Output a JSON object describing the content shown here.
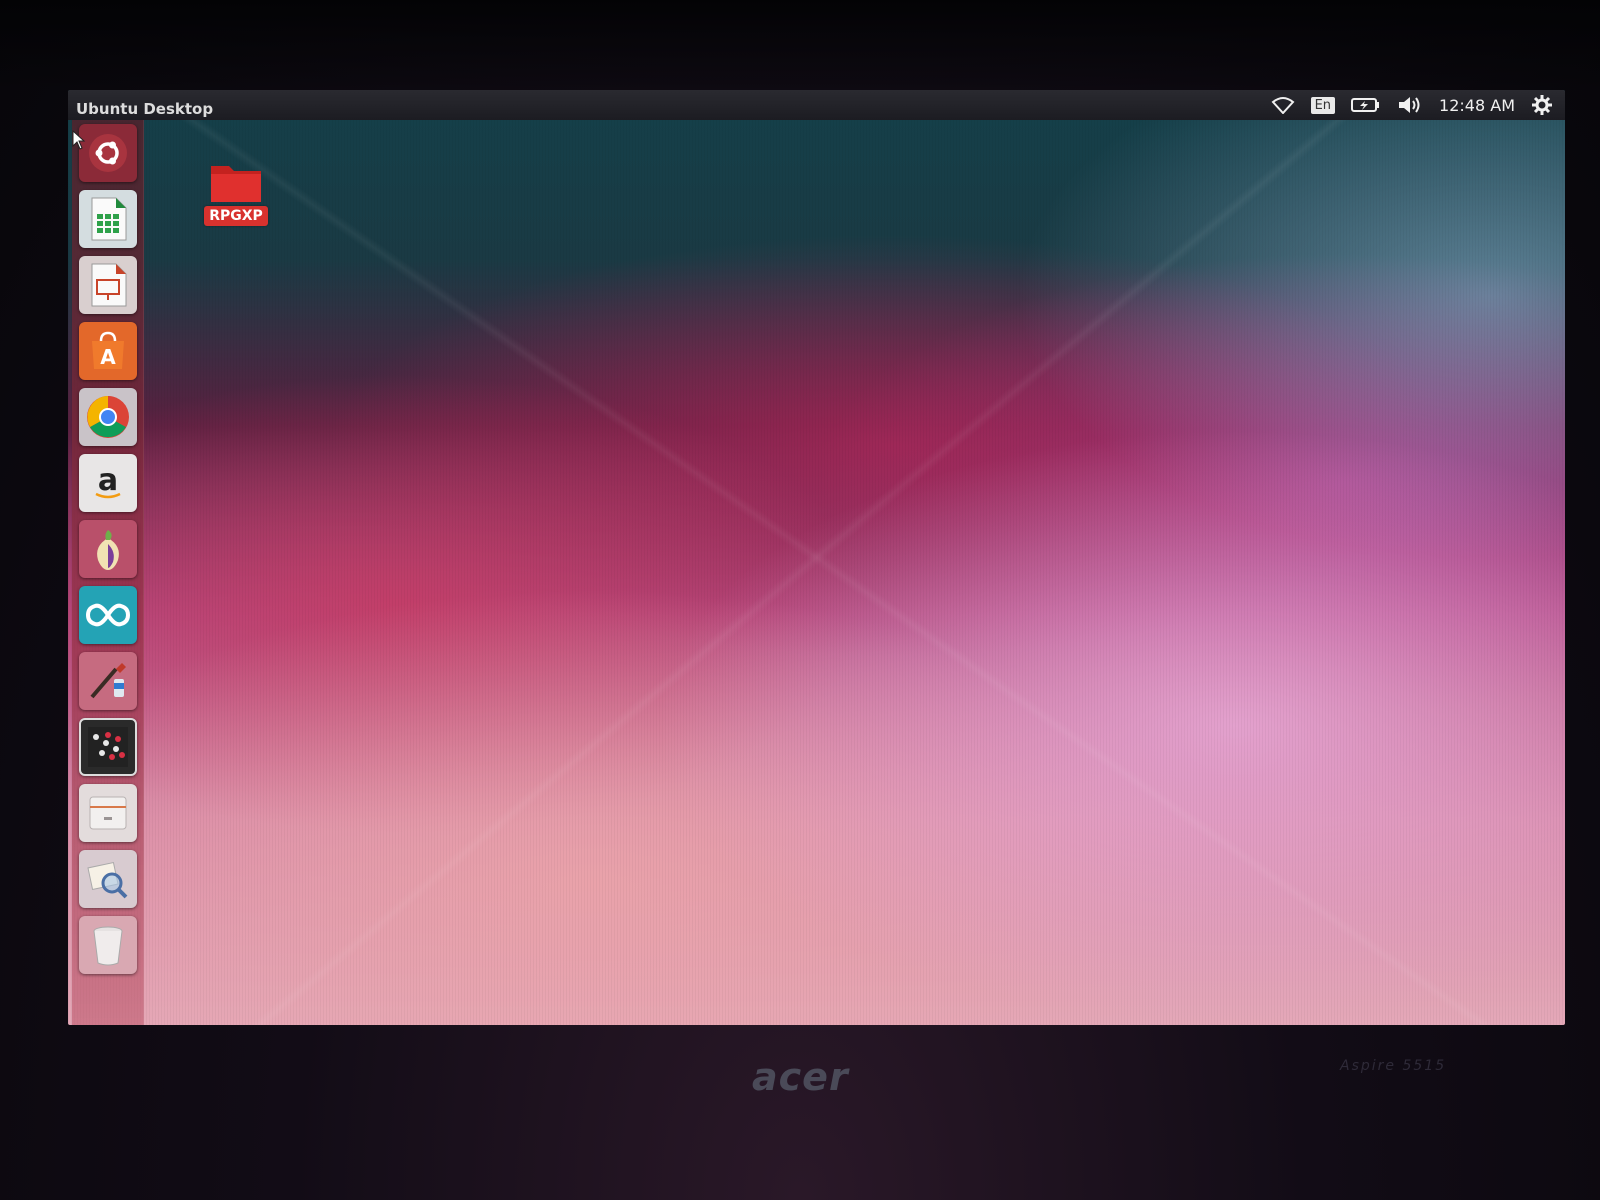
{
  "top_panel": {
    "window_title": "Ubuntu Desktop",
    "language": "En",
    "clock": "12:48 AM",
    "indicator_icons": [
      "wifi-icon",
      "battery-charging-icon",
      "volume-icon",
      "gear-icon"
    ]
  },
  "launcher": {
    "items": [
      {
        "name": "dash-home-icon"
      },
      {
        "name": "libreoffice-calc-icon"
      },
      {
        "name": "libreoffice-impress-icon"
      },
      {
        "name": "ubuntu-software-center-icon"
      },
      {
        "name": "chrome-icon"
      },
      {
        "name": "amazon-icon"
      },
      {
        "name": "tor-browser-icon"
      },
      {
        "name": "arduino-icon"
      },
      {
        "name": "paint-app-icon"
      },
      {
        "name": "checkers-game-icon"
      },
      {
        "name": "file-manager-icon"
      },
      {
        "name": "image-viewer-icon"
      },
      {
        "name": "trash-icon"
      }
    ]
  },
  "desktop": {
    "folder_label": "RPGXP",
    "folder_color": "#e0302e"
  },
  "bezel": {
    "brand": "acer",
    "model": "Aspire 5515"
  },
  "colors": {
    "panel": "#1c1c22",
    "launcher": "#8a2f44",
    "accent": "#e0302e"
  }
}
